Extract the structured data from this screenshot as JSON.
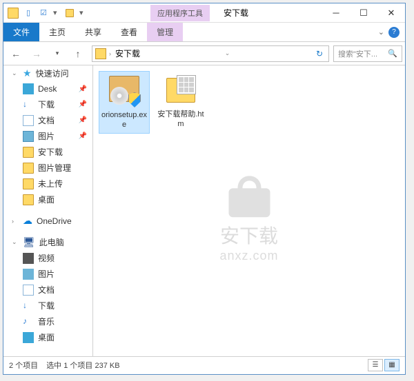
{
  "title_context": "应用程序工具",
  "title": "安下载",
  "ribbon": {
    "file": "文件",
    "home": "主页",
    "share": "共享",
    "view": "查看",
    "manage": "管理"
  },
  "breadcrumb": {
    "folder": "安下载"
  },
  "search": {
    "placeholder": "搜索\"安下..."
  },
  "sidebar": {
    "quick_access": "快速访问",
    "items": [
      "Desk",
      "下载",
      "文档",
      "图片",
      "安下载",
      "图片管理",
      "未上传",
      "桌面"
    ],
    "onedrive": "OneDrive",
    "thispc": "此电脑",
    "pc_items": [
      "视频",
      "图片",
      "文档",
      "下载",
      "音乐",
      "桌面"
    ]
  },
  "files": [
    {
      "name": "orionsetup.exe"
    },
    {
      "name": "安下载帮助.htm"
    }
  ],
  "watermark": {
    "cn": "安下载",
    "en": "anxz.com"
  },
  "status": {
    "count": "2 个项目",
    "selected": "选中 1 个项目  237 KB"
  }
}
